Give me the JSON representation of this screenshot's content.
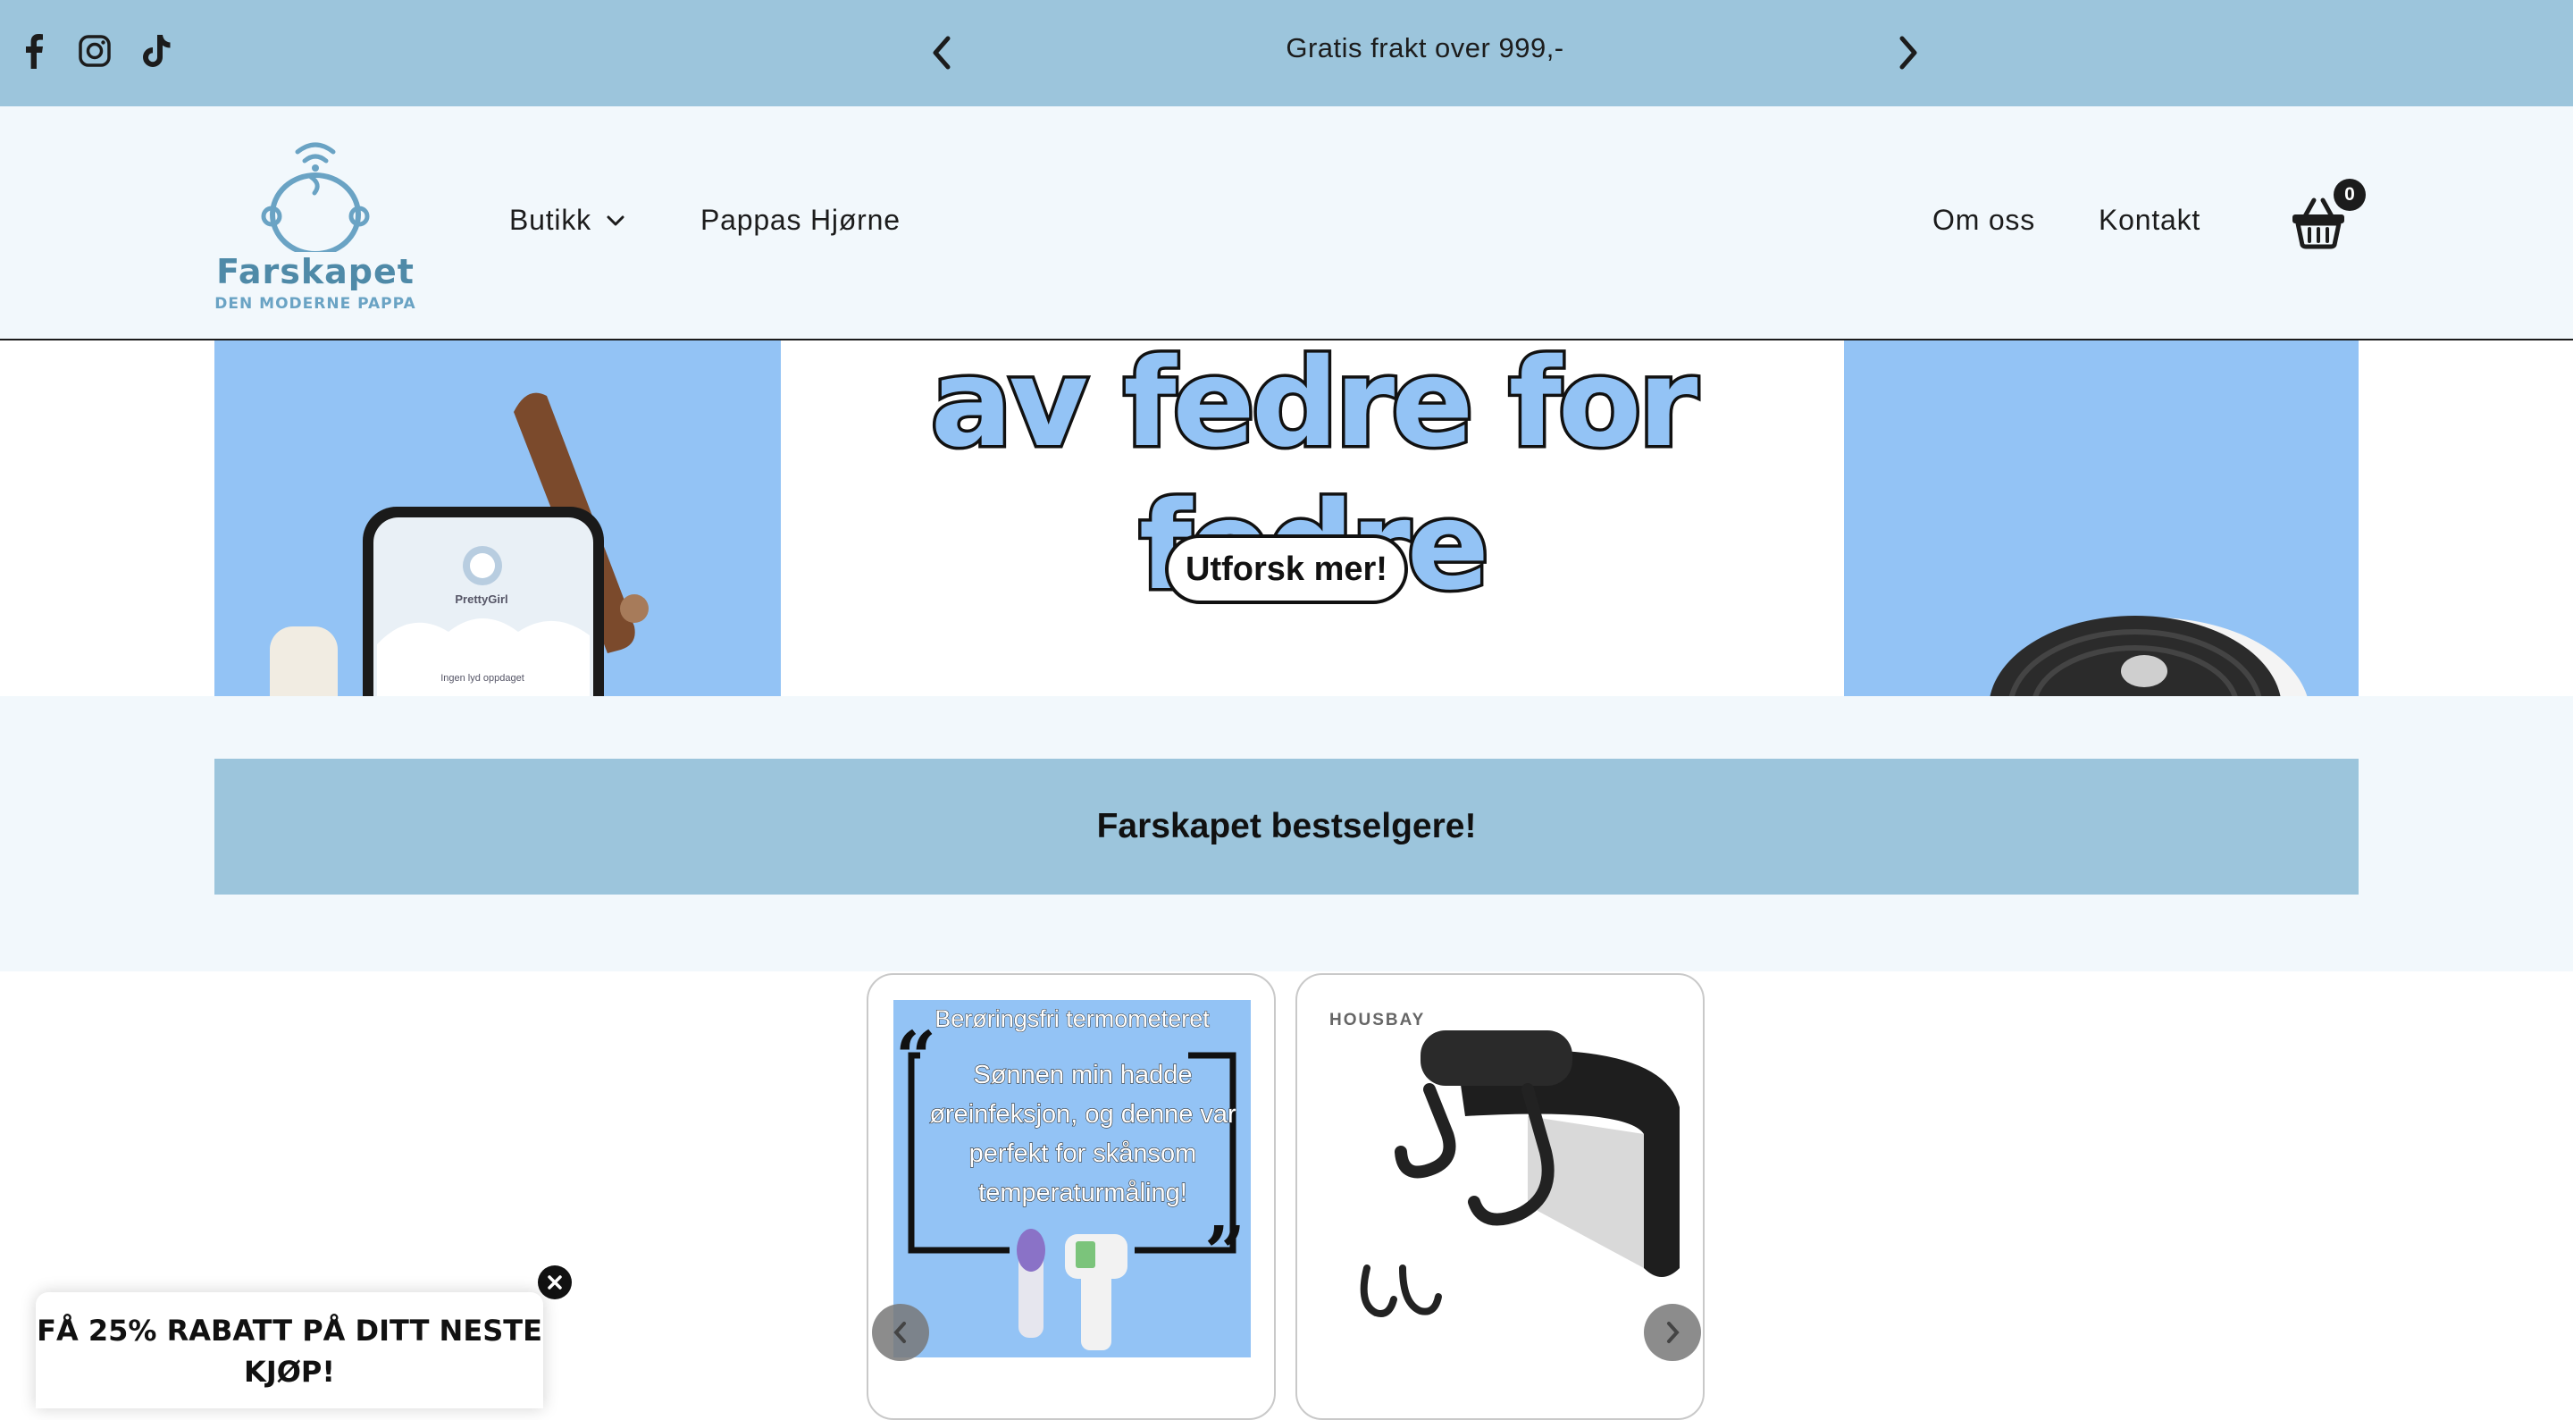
{
  "announcement": {
    "text": "Gratis frakt over 999,-",
    "prev_icon": "chevron-left-icon",
    "next_icon": "chevron-right-icon"
  },
  "social": [
    "facebook-icon",
    "instagram-icon",
    "tiktok-icon"
  ],
  "header": {
    "logo_name": "Farskapet",
    "logo_tagline": "DEN MODERNE PAPPA",
    "nav_left": [
      {
        "label": "Butikk",
        "dropdown": true
      },
      {
        "label": "Pappas Hjørne",
        "dropdown": false
      }
    ],
    "nav_right": [
      {
        "label": "Om oss"
      },
      {
        "label": "Kontakt"
      }
    ],
    "cart_count": "0"
  },
  "hero": {
    "headline": "av fedre for fedre",
    "button_label": "Utforsk mer!",
    "phone_app_name": "PrettyGirl",
    "phone_status": "Ingen lyd oppdaget"
  },
  "bestsellers": {
    "title": "Farskapet bestselgere!"
  },
  "products": [
    {
      "image_title": "Berøringsfri termometeret",
      "image_quote": "Sønnen min hadde øreinfeksjon, og denne var perfekt for skånsom temperaturmåling!"
    },
    {
      "image_brand": "HOUSBAY"
    }
  ],
  "popup": {
    "text": "FÅ 25% RABATT PÅ DITT NESTE KJØP!"
  },
  "colors": {
    "announcement_bg": "#9cc5dc",
    "header_bg": "#f2f8fc",
    "hero_blue": "#93c3f5",
    "logo_blue": "#4f8aa8",
    "text_dark": "#1c1c1c"
  }
}
